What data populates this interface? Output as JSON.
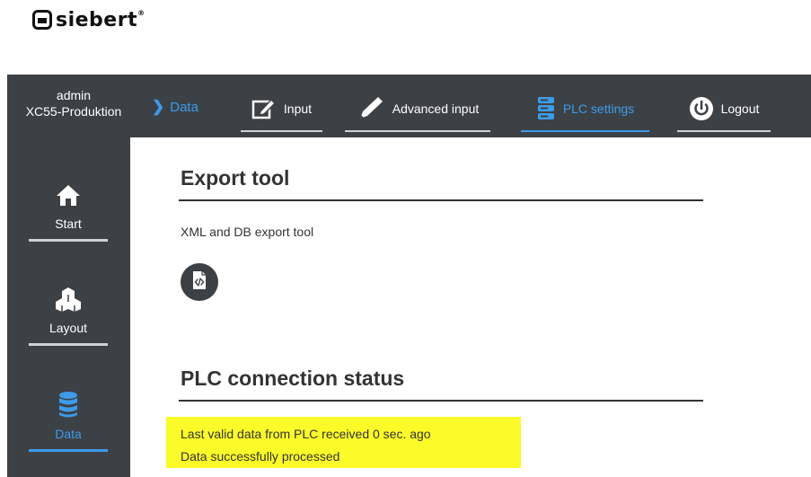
{
  "logo": {
    "text": "siebert",
    "reg": "®"
  },
  "header": {
    "user_name": "admin",
    "device_name": "XC55-Produktion",
    "breadcrumb": "Data",
    "nav": [
      {
        "label": "Input",
        "icon": "edit-icon",
        "active": false
      },
      {
        "label": "Advanced input",
        "icon": "pencil-icon",
        "active": false
      },
      {
        "label": "PLC settings",
        "icon": "server-icon",
        "active": true
      },
      {
        "label": "Logout",
        "icon": "power-icon",
        "active": false
      }
    ]
  },
  "sidebar": {
    "items": [
      {
        "label": "Start",
        "icon": "home-icon",
        "active": false
      },
      {
        "label": "Layout",
        "icon": "cubes-icon",
        "active": false
      },
      {
        "label": "Data",
        "icon": "database-icon",
        "active": true
      }
    ]
  },
  "main": {
    "export": {
      "title": "Export tool",
      "description": "XML and DB export tool",
      "button_icon": "code-file-icon"
    },
    "plc_status": {
      "title": "PLC connection status",
      "line1": "Last valid data from PLC received 0 sec. ago",
      "line2": "Data successfully processed",
      "highlight_color": "#fbfb2a"
    }
  },
  "colors": {
    "bar": "#3c4146",
    "accent": "#3d9be9",
    "text": "#333333"
  }
}
